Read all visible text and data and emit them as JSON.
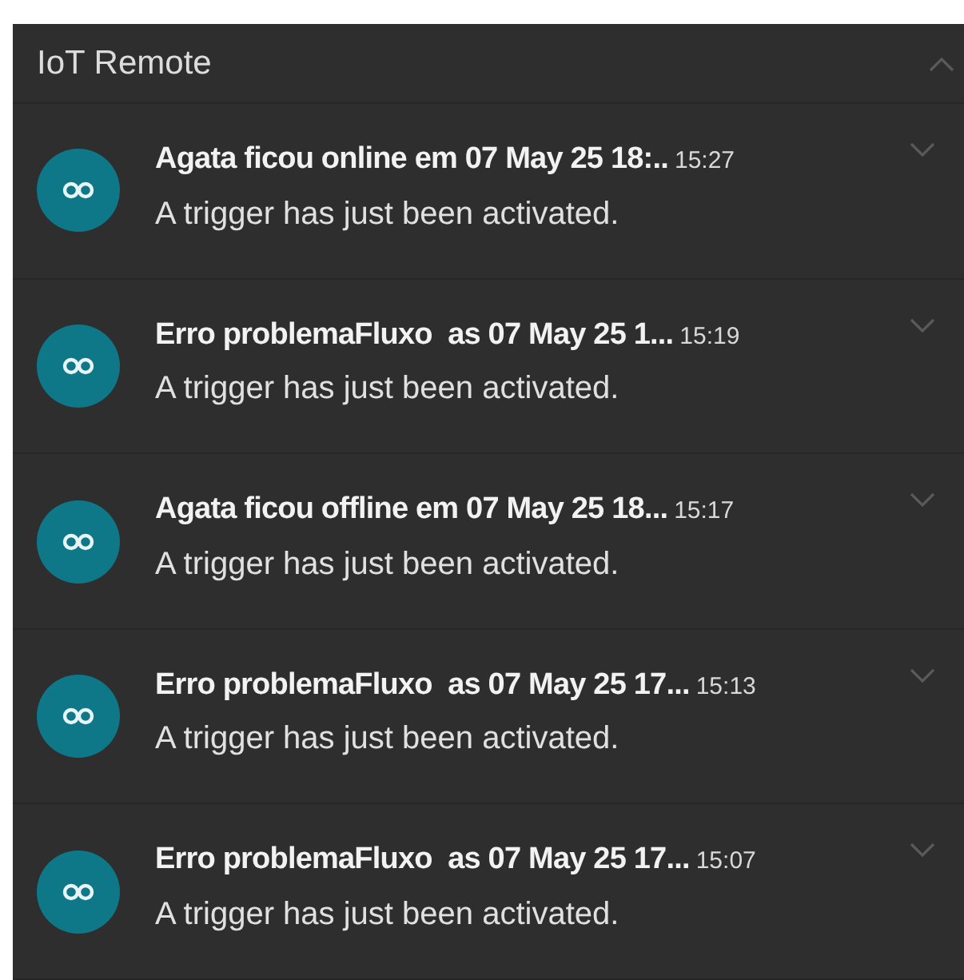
{
  "header": {
    "title": "IoT Remote",
    "expanded": true
  },
  "notifications": [
    {
      "title": "Agata ficou online em 07 May 25 18:..",
      "time": "15:27",
      "body": "A trigger has just been activated."
    },
    {
      "title": "Erro problemaFluxo  as 07 May 25 1...",
      "time": "15:19",
      "body": "A trigger has just been activated."
    },
    {
      "title": "Agata ficou offline em 07 May 25 18...",
      "time": "15:17",
      "body": "A trigger has just been activated."
    },
    {
      "title": "Erro problemaFluxo  as 07 May 25 17...",
      "time": "15:13",
      "body": "A trigger has just been activated."
    },
    {
      "title": "Erro problemaFluxo  as 07 May 25 17...",
      "time": "15:07",
      "body": "A trigger has just been activated."
    }
  ]
}
